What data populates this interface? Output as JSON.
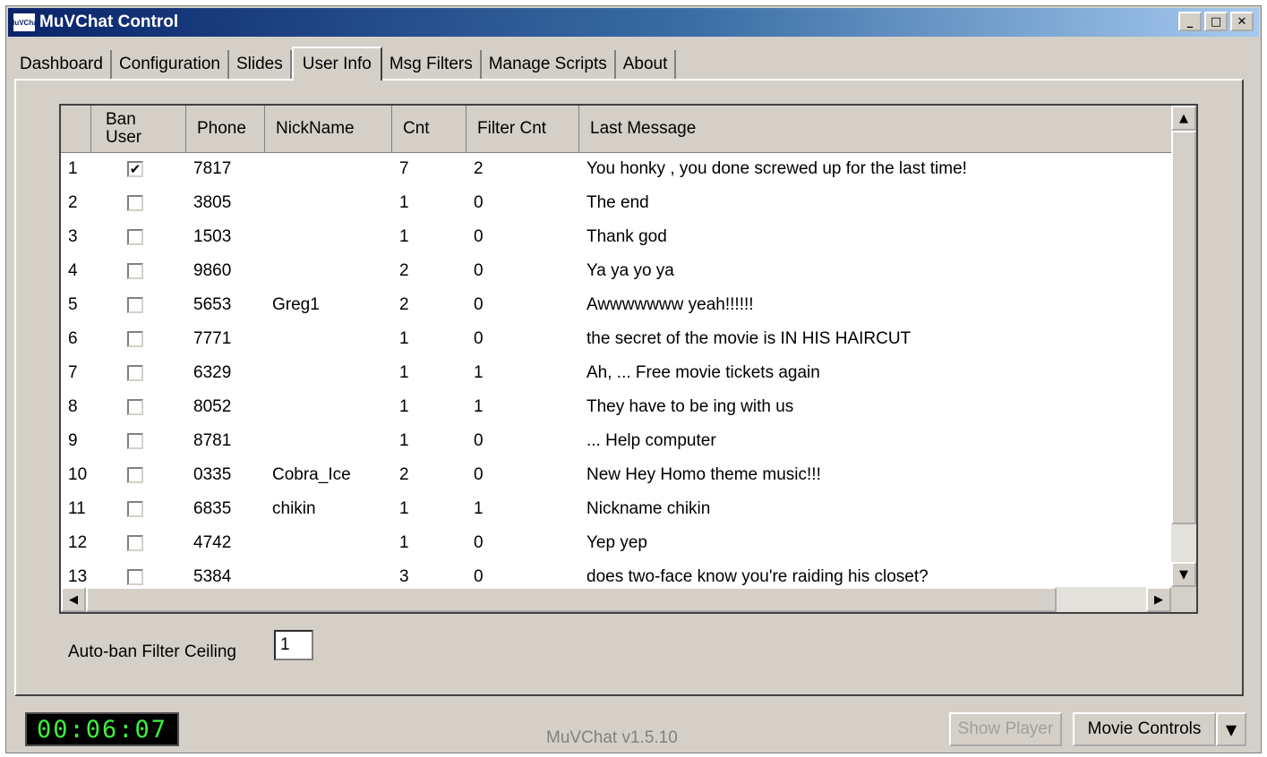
{
  "window": {
    "icon_text": "MuVChat",
    "title": "MuVChat Control",
    "minimize": "_",
    "maximize": "□",
    "close": "✕"
  },
  "tabs": [
    "Dashboard",
    "Configuration",
    "Slides",
    "User Info",
    "Msg Filters",
    "Manage Scripts",
    "About"
  ],
  "active_tab": "User Info",
  "grid": {
    "columns": {
      "ban_line1": "Ban",
      "ban_line2": "User",
      "phone": "Phone",
      "nick": "NickName",
      "cnt": "Cnt",
      "filter": "Filter Cnt",
      "last": "Last Message"
    },
    "rows": [
      {
        "num": "1",
        "ban": true,
        "phone": "7817",
        "nick": "",
        "cnt": "7",
        "filter": "2",
        "msg": "You honky  , you done screwed up for the last time!"
      },
      {
        "num": "2",
        "ban": false,
        "phone": "3805",
        "nick": "",
        "cnt": "1",
        "filter": "0",
        "msg": "The end"
      },
      {
        "num": "3",
        "ban": false,
        "phone": "1503",
        "nick": "",
        "cnt": "1",
        "filter": "0",
        "msg": "Thank god"
      },
      {
        "num": "4",
        "ban": false,
        "phone": "9860",
        "nick": "",
        "cnt": "2",
        "filter": "0",
        "msg": "Ya ya yo ya"
      },
      {
        "num": "5",
        "ban": false,
        "phone": "5653",
        "nick": "Greg1",
        "cnt": "2",
        "filter": "0",
        "msg": "Awwwwwww yeah!!!!!!"
      },
      {
        "num": "6",
        "ban": false,
        "phone": "7771",
        "nick": "",
        "cnt": "1",
        "filter": "0",
        "msg": "the secret of the movie is IN HIS HAIRCUT"
      },
      {
        "num": "7",
        "ban": false,
        "phone": "6329",
        "nick": "",
        "cnt": "1",
        "filter": "1",
        "msg": "Ah,  ... Free movie tickets again"
      },
      {
        "num": "8",
        "ban": false,
        "phone": "8052",
        "nick": "",
        "cnt": "1",
        "filter": "1",
        "msg": "They have to be  ing with us"
      },
      {
        "num": "9",
        "ban": false,
        "phone": "8781",
        "nick": "",
        "cnt": "1",
        "filter": "0",
        "msg": "... Help computer"
      },
      {
        "num": "10",
        "ban": false,
        "phone": "0335",
        "nick": "Cobra_Ice",
        "cnt": "2",
        "filter": "0",
        "msg": "New Hey Homo theme music!!!"
      },
      {
        "num": "11",
        "ban": false,
        "phone": "6835",
        "nick": "chikin",
        "cnt": "1",
        "filter": "1",
        "msg": "Nickname chikin"
      },
      {
        "num": "12",
        "ban": false,
        "phone": "4742",
        "nick": "",
        "cnt": "1",
        "filter": "0",
        "msg": "Yep yep"
      },
      {
        "num": "13",
        "ban": false,
        "phone": "5384",
        "nick": "",
        "cnt": "3",
        "filter": "0",
        "msg": "does two-face know you're raiding his closet?"
      }
    ]
  },
  "auto_ban": {
    "label": "Auto-ban Filter Ceiling",
    "value": "1"
  },
  "timer": "00:06:07",
  "version": "MuVChat v1.5.10",
  "buttons": {
    "show_player": "Show Player",
    "movie_controls": "Movie Controls"
  },
  "icons": {
    "scroll_up": "▲",
    "scroll_down": "▼",
    "scroll_left": "◀",
    "scroll_right": "▶",
    "check": "✔",
    "dropdown": "▼"
  },
  "colors": {
    "title_start": "#0a246a",
    "title_end": "#a6caf0",
    "face": "#d4d0c8",
    "timer_fg": "#3cf03c"
  }
}
